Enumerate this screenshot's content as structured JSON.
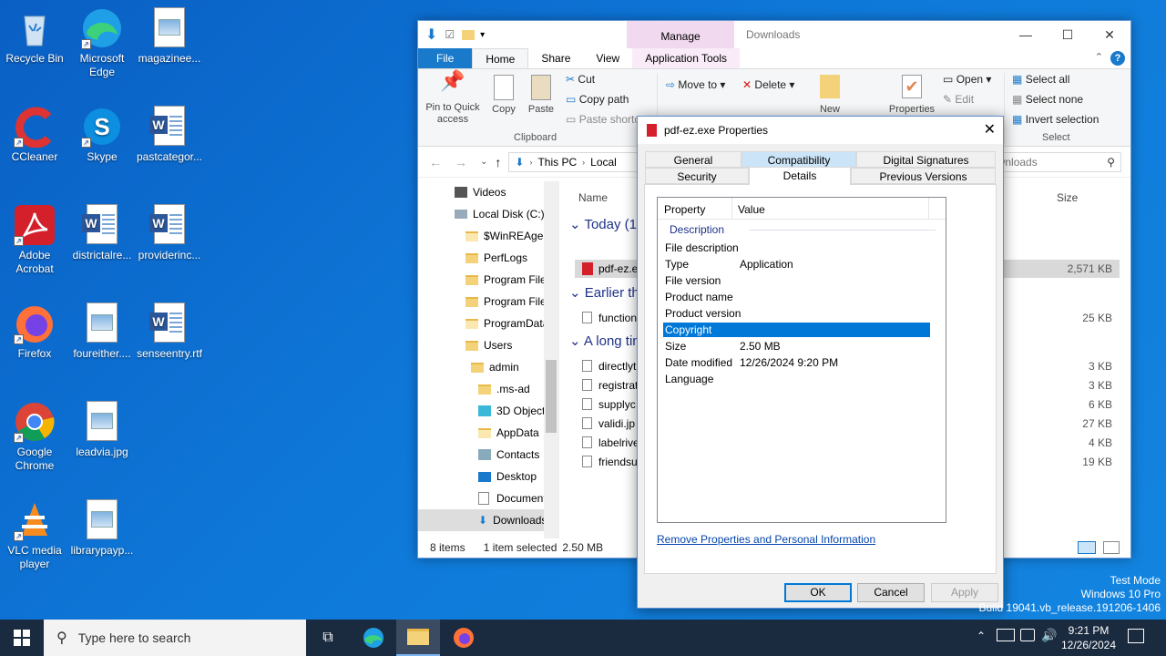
{
  "desktop": {
    "icons": [
      {
        "label": "Recycle Bin"
      },
      {
        "label": "Microsoft Edge"
      },
      {
        "label": "magazinee..."
      },
      {
        "label": "CCleaner"
      },
      {
        "label": "Skype"
      },
      {
        "label": "pastcategor..."
      },
      {
        "label": "Adobe Acrobat"
      },
      {
        "label": "districtalre..."
      },
      {
        "label": "providerinc..."
      },
      {
        "label": "Firefox"
      },
      {
        "label": "foureither...."
      },
      {
        "label": "senseentry.rtf"
      },
      {
        "label": "Google Chrome"
      },
      {
        "label": "leadvia.jpg"
      },
      {
        "label": "VLC media player"
      },
      {
        "label": "librarypayp..."
      }
    ]
  },
  "explorer": {
    "title": "Downloads",
    "manage_label": "Manage",
    "tabs": [
      "File",
      "Home",
      "Share",
      "View",
      "Application Tools"
    ],
    "ribbon": {
      "pin": "Pin to Quick access",
      "copy": "Copy",
      "paste": "Paste",
      "cut": "Cut",
      "copy_path": "Copy path",
      "paste_shortcut": "Paste shortcut",
      "clipboard": "Clipboard",
      "move_to": "Move to",
      "delete": "Delete",
      "new": "New",
      "properties": "Properties",
      "open": "Open",
      "edit": "Edit",
      "select_all": "Select all",
      "select_none": "Select none",
      "invert": "Invert selection",
      "select": "Select"
    },
    "address": {
      "path": [
        "This PC",
        "Local"
      ],
      "search_placeholder": "Search Downloads"
    },
    "tree": [
      {
        "label": "Videos"
      },
      {
        "label": "Local Disk (C:)"
      },
      {
        "label": "$WinREAgent"
      },
      {
        "label": "PerfLogs"
      },
      {
        "label": "Program Files"
      },
      {
        "label": "Program Files"
      },
      {
        "label": "ProgramData"
      },
      {
        "label": "Users"
      },
      {
        "label": "admin"
      },
      {
        "label": ".ms-ad"
      },
      {
        "label": "3D Objects"
      },
      {
        "label": "AppData"
      },
      {
        "label": "Contacts"
      },
      {
        "label": "Desktop"
      },
      {
        "label": "Documents"
      },
      {
        "label": "Downloads"
      }
    ],
    "columns": {
      "name": "Name",
      "size": "Size"
    },
    "groups": {
      "today": "Today (1)",
      "earlier": "Earlier this",
      "longtime": "A long time"
    },
    "files": [
      {
        "name": "pdf-ez.exe",
        "size": "2,571 KB"
      },
      {
        "name": "function",
        "size": "25 KB"
      },
      {
        "name": "directlyt",
        "size": "3 KB"
      },
      {
        "name": "registrat",
        "size": "3 KB"
      },
      {
        "name": "supplyc",
        "size": "6 KB"
      },
      {
        "name": "validi.jp",
        "size": "27 KB"
      },
      {
        "name": "labelrive",
        "size": "4 KB"
      },
      {
        "name": "friendsu",
        "size": "19 KB"
      }
    ],
    "status": {
      "items": "8 items",
      "selected": "1 item selected",
      "size": "2.50 MB"
    }
  },
  "dialog": {
    "title": "pdf-ez.exe Properties",
    "tabs_row1": [
      "General",
      "Compatibility",
      "Digital Signatures"
    ],
    "tabs_row2": [
      "Security",
      "Details",
      "Previous Versions"
    ],
    "header": {
      "property": "Property",
      "value": "Value"
    },
    "section": "Description",
    "rows": [
      {
        "k": "File description",
        "v": ""
      },
      {
        "k": "Type",
        "v": "Application"
      },
      {
        "k": "File version",
        "v": ""
      },
      {
        "k": "Product name",
        "v": ""
      },
      {
        "k": "Product version",
        "v": ""
      },
      {
        "k": "Copyright",
        "v": ""
      },
      {
        "k": "Size",
        "v": "2.50 MB"
      },
      {
        "k": "Date modified",
        "v": "12/26/2024 9:20 PM"
      },
      {
        "k": "Language",
        "v": ""
      }
    ],
    "link": "Remove Properties and Personal Information",
    "ok": "OK",
    "cancel": "Cancel",
    "apply": "Apply"
  },
  "watermark": {
    "mode": "Test Mode",
    "os": "Windows 10 Pro",
    "build": "Build 19041.vb_release.191206-1406"
  },
  "taskbar": {
    "search_placeholder": "Type here to search",
    "time": "9:21 PM",
    "date": "12/26/2024"
  }
}
